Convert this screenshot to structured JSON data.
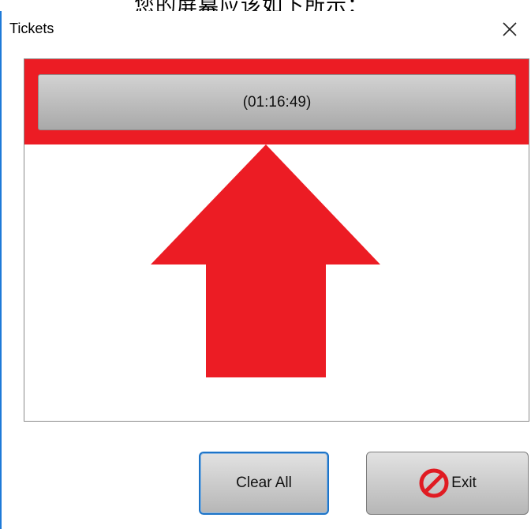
{
  "caption": "您的屏幕应该如下所示：",
  "window": {
    "title": "Tickets",
    "close_icon": "close-icon"
  },
  "tickets": [
    {
      "label": "(01:16:49)",
      "highlighted": true
    }
  ],
  "annotation": {
    "arrow_icon": "up-arrow-icon",
    "color": "#ec1c24"
  },
  "buttons": {
    "clear_all": "Clear All",
    "exit": "Exit",
    "exit_icon": "no-sign-icon"
  },
  "colors": {
    "highlight": "#ec1c24",
    "focus_border": "#1d74c8",
    "window_border": "#1e7ad8"
  }
}
